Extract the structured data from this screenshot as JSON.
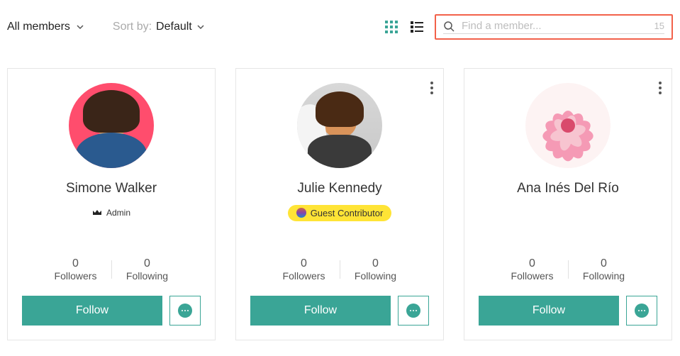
{
  "toolbar": {
    "filter_label": "All members",
    "sort_label": "Sort by:",
    "sort_value": "Default"
  },
  "search": {
    "placeholder": "Find a member...",
    "count": "15"
  },
  "stats_labels": {
    "followers": "Followers",
    "following": "Following"
  },
  "buttons": {
    "follow": "Follow"
  },
  "members": [
    {
      "name": "Simone Walker",
      "role_type": "admin",
      "role_label": "Admin",
      "followers": "0",
      "following": "0",
      "has_menu": false
    },
    {
      "name": "Julie Kennedy",
      "role_type": "guest",
      "role_label": "Guest Contributor",
      "followers": "0",
      "following": "0",
      "has_menu": true
    },
    {
      "name": "Ana Inés Del Río",
      "role_type": "none",
      "role_label": "",
      "followers": "0",
      "following": "0",
      "has_menu": true
    }
  ]
}
